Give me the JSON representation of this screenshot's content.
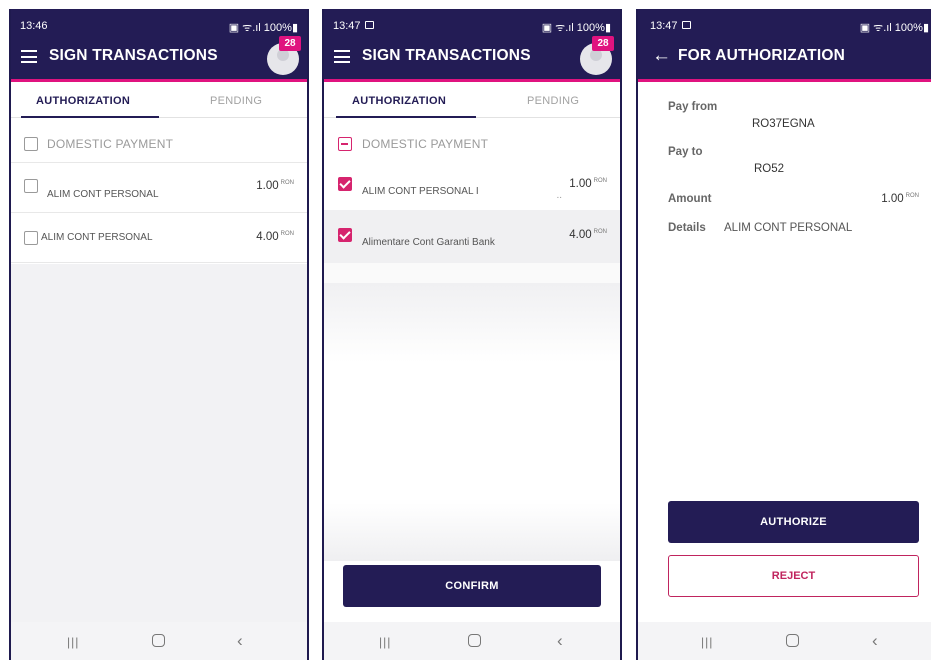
{
  "colors": {
    "primary": "#231c55",
    "accent": "#e0137f",
    "checkbox": "#d6246e",
    "reject": "#c0245e"
  },
  "screen1": {
    "status_time": "13:46",
    "status_right": "▣ ᯤ.ıl 100%▮",
    "title": "SIGN TRANSACTIONS",
    "badge": "28",
    "tab_authorization": "AUTHORIZATION",
    "tab_pending": "PENDING",
    "group_label": "DOMESTIC PAYMENT",
    "rows": [
      {
        "name": "ALIM CONT PERSONAL",
        "amount": "1.00",
        "currency": "RON"
      },
      {
        "name": "ALIM CONT PERSONAL",
        "amount": "4.00",
        "currency": "RON"
      }
    ],
    "nav": {
      "recent": "|||",
      "back": "‹"
    }
  },
  "screen2": {
    "status_time": "13:47",
    "status_right": "▣ ᯤ.ıl 100%▮",
    "title": "SIGN TRANSACTIONS",
    "badge": "28",
    "tab_authorization": "AUTHORIZATION",
    "tab_pending": "PENDING",
    "group_label": "DOMESTIC PAYMENT",
    "rows": [
      {
        "name": "ALIM CONT PERSONAL I",
        "amount": "1.00",
        "currency": "RON",
        "extra": ".."
      },
      {
        "name": "Alimentare Cont Garanti Bank",
        "amount": "4.00",
        "currency": "RON"
      }
    ],
    "confirm_label": "CONFIRM",
    "nav": {
      "recent": "|||",
      "back": "‹"
    }
  },
  "screen3": {
    "status_time": "13:47",
    "status_right": "▣ ᯤ.ıl 100%▮",
    "title": "FOR AUTHORIZATION",
    "back_icon": "←",
    "pay_from_label": "Pay from",
    "pay_from_value": "RO37EGNA",
    "pay_to_label": "Pay to",
    "pay_to_value": "RO52",
    "amount_label": "Amount",
    "amount_value": "1.00",
    "amount_currency": "RON",
    "details_label": "Details",
    "details_value": "ALIM CONT PERSONAL",
    "authorize_label": "AUTHORIZE",
    "reject_label": "REJECT",
    "nav": {
      "recent": "|||",
      "back": "‹"
    }
  }
}
